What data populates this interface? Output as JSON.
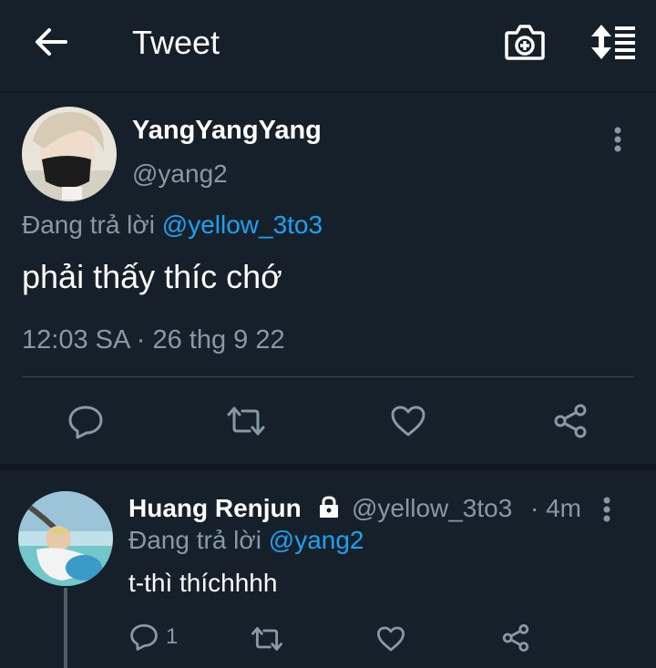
{
  "header": {
    "title": "Tweet",
    "back_icon": "arrow-left-icon",
    "camera_icon": "camera-plus-icon",
    "sort_icon": "sort-icon"
  },
  "main_tweet": {
    "author_name": "YangYangYang",
    "handle": "@yang2",
    "reply_prefix": "Đang trả lời",
    "reply_to": "@yellow_3to3",
    "text": "phải thấy thíc chớ",
    "timestamp": "12:03 SA · 26 thg 9 22"
  },
  "reply_tweet": {
    "author_name": "Huang Renjun",
    "handle": "@yellow_3to3",
    "time": "· 4m",
    "reply_prefix": "Đang trả lời",
    "reply_to": "@yang2",
    "text": "t-thì thíchhhh",
    "reply_count": "1"
  },
  "colors": {
    "background": "#15202b",
    "secondary_text": "#8899a6",
    "accent": "#1da1f2"
  }
}
